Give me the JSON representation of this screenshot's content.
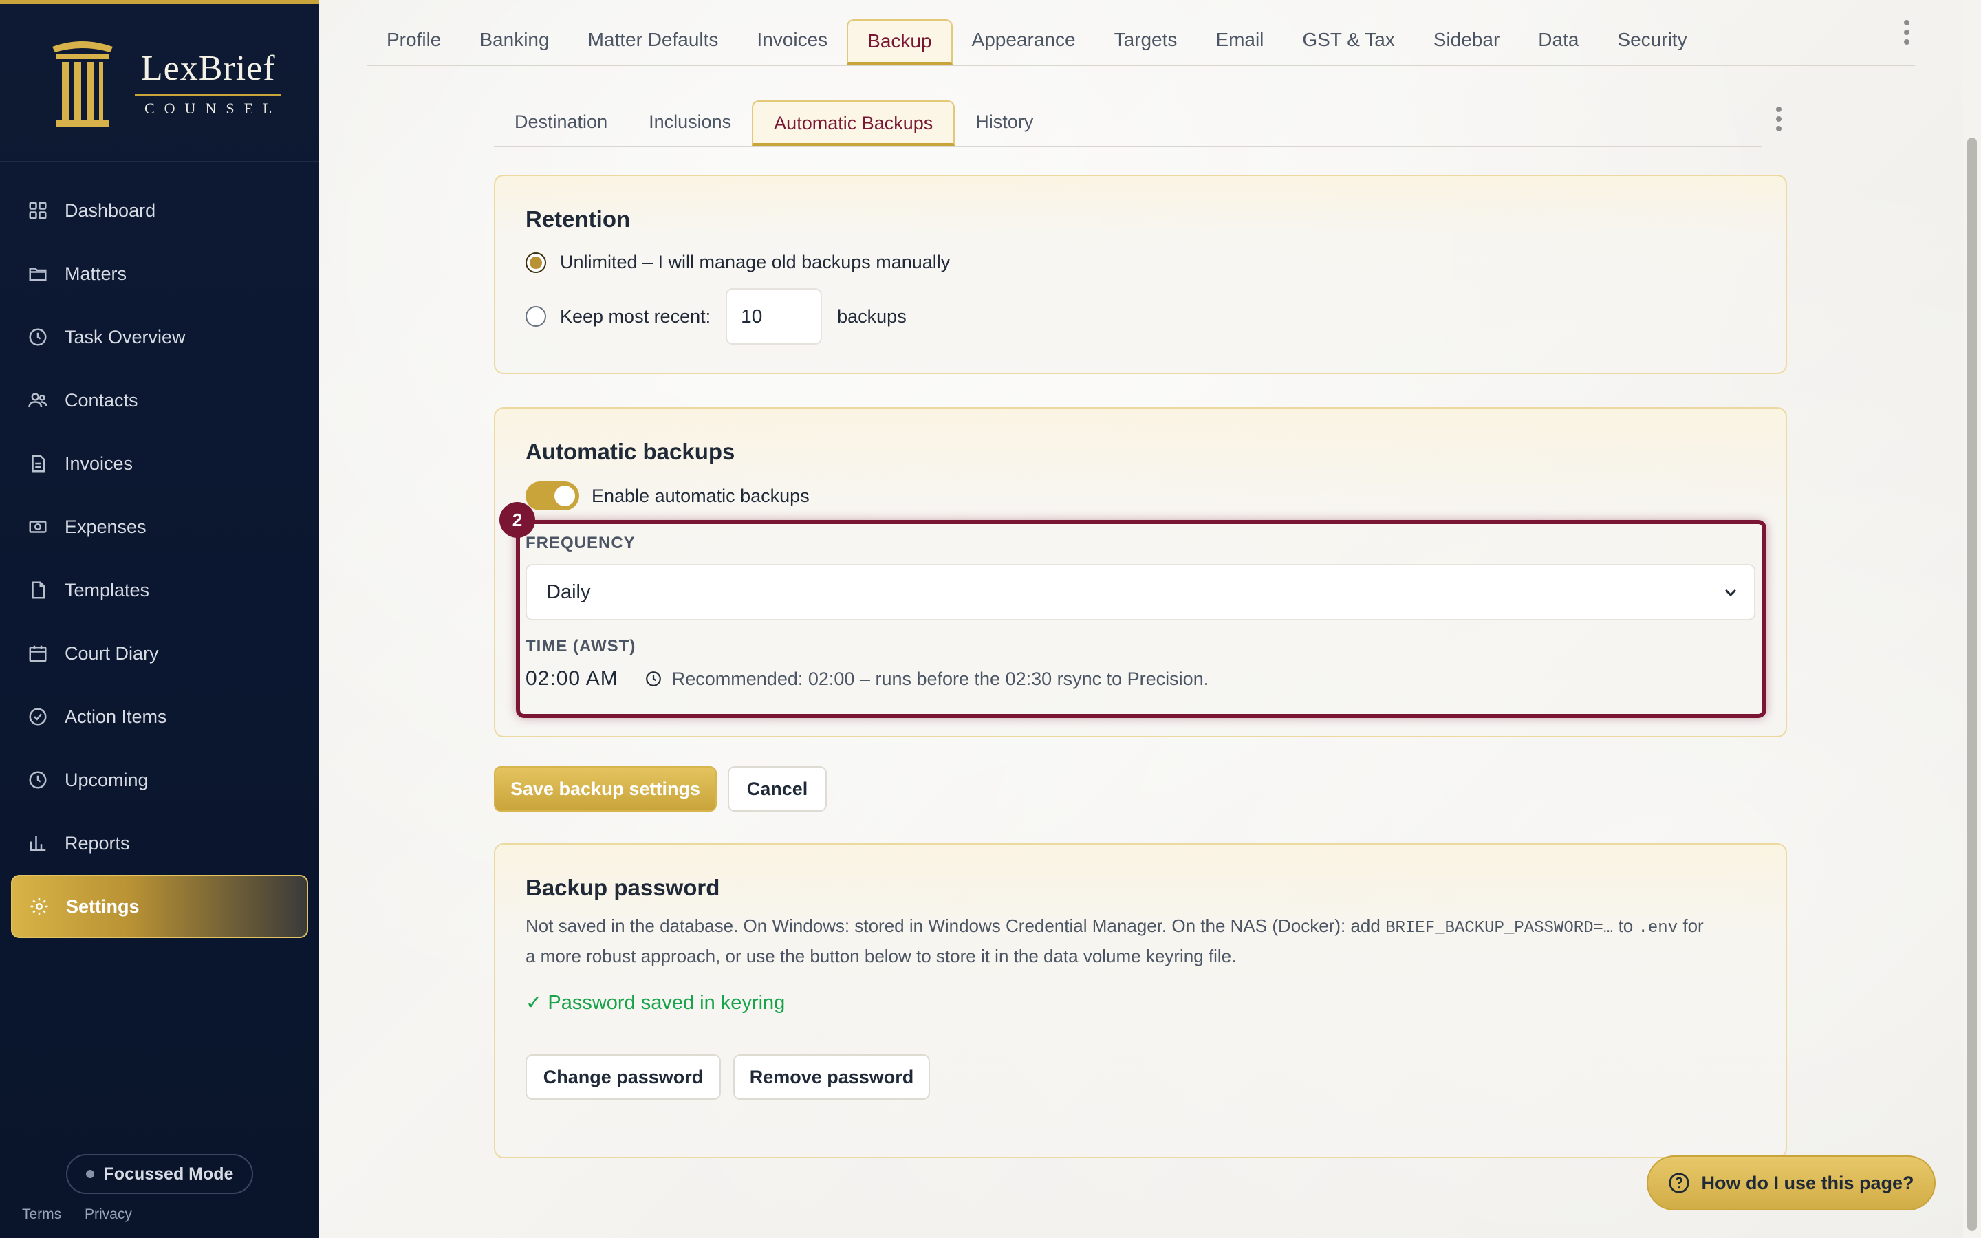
{
  "brand": {
    "name": "LexBrief",
    "sub": "COUNSEL"
  },
  "sidebar": {
    "items": [
      {
        "label": "Dashboard",
        "icon": "grid-icon"
      },
      {
        "label": "Matters",
        "icon": "folder-icon"
      },
      {
        "label": "Task Overview",
        "icon": "clock-icon"
      },
      {
        "label": "Contacts",
        "icon": "users-icon"
      },
      {
        "label": "Invoices",
        "icon": "document-icon"
      },
      {
        "label": "Expenses",
        "icon": "money-icon"
      },
      {
        "label": "Templates",
        "icon": "file-icon"
      },
      {
        "label": "Court Diary",
        "icon": "calendar-icon"
      },
      {
        "label": "Action Items",
        "icon": "check-circle-icon"
      },
      {
        "label": "Upcoming",
        "icon": "clock-icon"
      },
      {
        "label": "Reports",
        "icon": "bar-chart-icon"
      },
      {
        "label": "Settings",
        "icon": "gear-icon"
      }
    ],
    "focus_mode": "Focussed Mode",
    "terms": "Terms",
    "privacy": "Privacy"
  },
  "top_tabs": [
    "Profile",
    "Banking",
    "Matter Defaults",
    "Invoices",
    "Backup",
    "Appearance",
    "Targets",
    "Email",
    "GST & Tax",
    "Sidebar",
    "Data",
    "Security"
  ],
  "sub_tabs": [
    "Destination",
    "Inclusions",
    "Automatic Backups",
    "History"
  ],
  "retention": {
    "title": "Retention",
    "option_unlimited": "Unlimited – I will manage old backups manually",
    "option_keep": "Keep most recent:",
    "keep_value": "10",
    "keep_suffix": "backups"
  },
  "auto": {
    "title": "Automatic backups",
    "toggle_label": "Enable automatic backups",
    "step_badge": "2",
    "frequency_label": "FREQUENCY",
    "frequency_value": "Daily",
    "time_label": "TIME (AWST)",
    "time_value": "02:00 AM",
    "recommendation": "Recommended: 02:00 – runs before the 02:30 rsync to Precision."
  },
  "actions": {
    "save": "Save backup settings",
    "cancel": "Cancel"
  },
  "password": {
    "title": "Backup password",
    "desc_1": "Not saved in the database. On Windows: stored in Windows Credential Manager. On the NAS (Docker): add",
    "desc_code1": "BRIEF_BACKUP_PASSWORD=…",
    "desc_2": "to",
    "desc_code2": ".env",
    "desc_3": "for",
    "desc_line2": "a more robust approach, or use the button below to store it in the data volume keyring file.",
    "status": "✓ Password saved in keyring",
    "change": "Change password",
    "remove": "Remove password"
  },
  "help": "How do I use this page?",
  "colors": {
    "accent_gold": "#c9a43a",
    "accent_maroon": "#7a1533",
    "sidebar_bg": "#0e1a33",
    "success": "#16a34a"
  }
}
